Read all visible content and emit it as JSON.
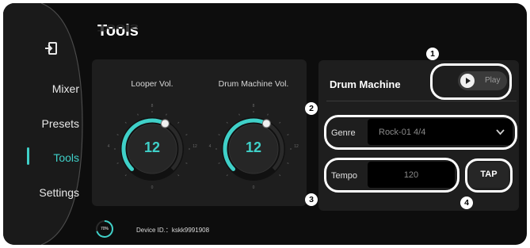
{
  "sidebar": {
    "items": [
      {
        "label": "Mixer"
      },
      {
        "label": "Presets"
      },
      {
        "label": "Tools"
      },
      {
        "label": "Settings"
      }
    ]
  },
  "page": {
    "title": "Tools"
  },
  "looper": {
    "label": "Looper Vol.",
    "value": "12",
    "level": 0.6
  },
  "drum_vol": {
    "label": "Drum Machine Vol.",
    "value": "12",
    "level": 0.6
  },
  "knob_ticks": {
    "top": "8",
    "left": "4",
    "right": "12",
    "bottom": "0"
  },
  "drum_machine": {
    "title": "Drum Machine",
    "play_label": "Play",
    "genre_label": "Genre",
    "genre_value": "Rock-01 4/4",
    "tempo_label": "Tempo",
    "tempo_value": "120",
    "tap_label": "TAP"
  },
  "callouts": [
    "1",
    "2",
    "3",
    "4"
  ],
  "footer": {
    "progress_label": "70%",
    "progress": 0.7,
    "device_id": "Device ID.：kskk9991908"
  },
  "colors": {
    "accent": "#3fd0c8",
    "background": "#0d0d0d",
    "panel": "#1c1c1c"
  }
}
